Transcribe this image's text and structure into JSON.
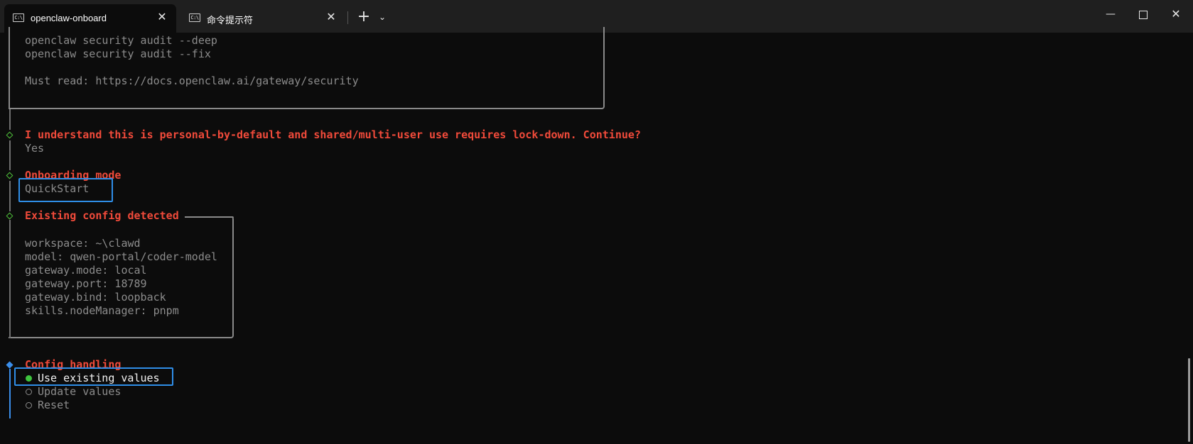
{
  "tabs": [
    {
      "label": "openclaw-onboard",
      "icon": "C:\\"
    },
    {
      "label": "命令提示符",
      "icon": "C:\\"
    }
  ],
  "tab_close_glyph": "✕",
  "new_tab_glyph": "+",
  "dropdown_glyph": "⌄",
  "window_controls": {
    "minimize": "—",
    "close": "✕"
  },
  "security_box": {
    "lines": [
      "openclaw security audit --deep",
      "openclaw security audit --fix",
      "",
      "Must read: https://docs.openclaw.ai/gateway/security"
    ]
  },
  "prompt_continue": {
    "question": "I understand this is personal-by-default and shared/multi-user use requires lock-down. Continue?",
    "answer": "Yes"
  },
  "onboarding_mode": {
    "label": "Onboarding mode",
    "value": "QuickStart"
  },
  "existing_config": {
    "title": "Existing config detected",
    "lines": [
      "workspace: ~\\clawd",
      "model: qwen-portal/coder-model",
      "gateway.mode: local",
      "gateway.port: 18789",
      "gateway.bind: loopback",
      "skills.nodeManager: pnpm"
    ]
  },
  "config_handling": {
    "label": "Config handling",
    "options": [
      {
        "label": "Use existing values",
        "selected": true
      },
      {
        "label": "Update values",
        "selected": false
      },
      {
        "label": "Reset",
        "selected": false
      }
    ]
  },
  "colors": {
    "background": "#0c0c0c",
    "prompt_red": "#f04a3a",
    "muted_text": "#8c8c8c",
    "highlight_blue": "#2f8ee8",
    "selected_green": "#3ec43e"
  }
}
